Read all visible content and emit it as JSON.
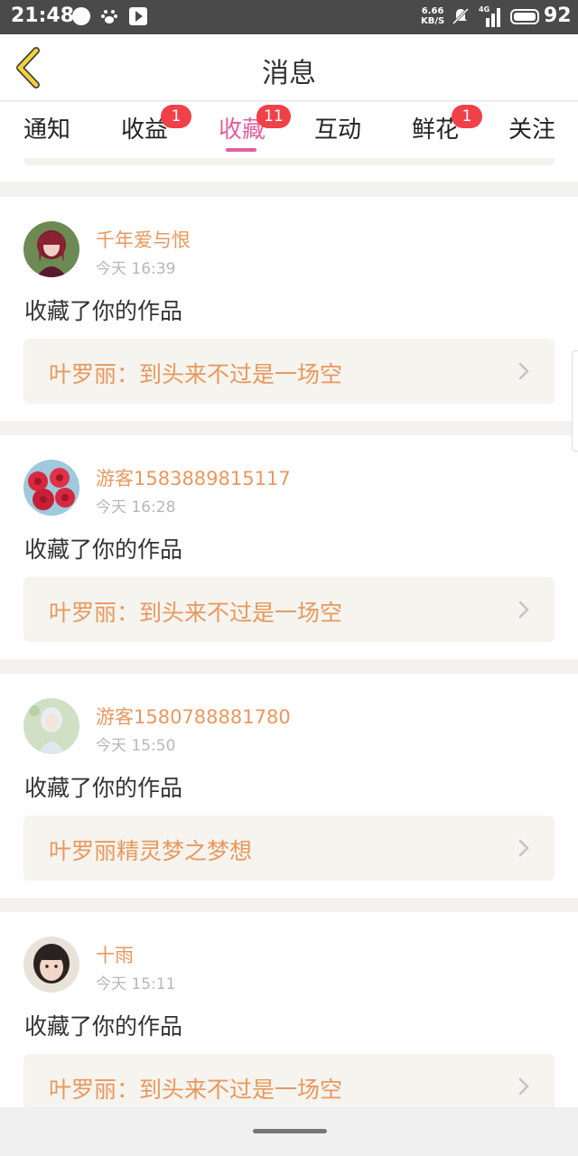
{
  "status_bar": {
    "time": "21:48",
    "speed_value": "6.66",
    "speed_unit": "KB/S",
    "network": "4G",
    "battery": "92",
    "icons": [
      "message-dot-icon",
      "baidu-paw-icon",
      "video-play-icon",
      "muted-bell-icon",
      "signal-icon",
      "battery-icon"
    ]
  },
  "header": {
    "title": "消息",
    "back_icon": "chevron-left-icon",
    "accent": "#f5c518"
  },
  "tabs": [
    {
      "label": "通知",
      "badge": ""
    },
    {
      "label": "收益",
      "badge": "1"
    },
    {
      "label": "收藏",
      "badge": "11",
      "active": true
    },
    {
      "label": "互动",
      "badge": ""
    },
    {
      "label": "鲜花",
      "badge": "1"
    },
    {
      "label": "关注",
      "badge": ""
    }
  ],
  "colors": {
    "active_tab": "#e0609e",
    "badge": "#f04149",
    "username": "#e8985f",
    "work_title": "#e8985f",
    "work_bg": "#f5f4ee"
  },
  "messages": [
    {
      "user": "千年爱与恨",
      "time": "今天 16:39",
      "action": "收藏了你的作品",
      "work": "叶罗丽：到头来不过是一场空"
    },
    {
      "user": "游客1583889815117",
      "time": "今天 16:28",
      "action": "收藏了你的作品",
      "work": "叶罗丽：到头来不过是一场空"
    },
    {
      "user": "游客1580788881780",
      "time": "今天 15:50",
      "action": "收藏了你的作品",
      "work": "叶罗丽精灵梦之梦想"
    },
    {
      "user": "十雨",
      "time": "今天 15:11",
      "action": "收藏了你的作品",
      "work": "叶罗丽：到头来不过是一场空"
    }
  ]
}
